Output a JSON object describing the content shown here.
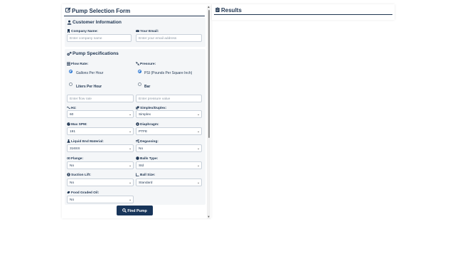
{
  "form": {
    "title": "Pump Selection Form",
    "customer_section": {
      "title": "Customer Information",
      "company_label": "Company Name:",
      "company_placeholder": "Enter company name",
      "email_label": "Your Email:",
      "email_placeholder": "Enter your email address"
    },
    "specs_section": {
      "title": "Pump Specifications",
      "flow_rate_label": "Flow Rate:",
      "flow_option_1": "Gallons Per Hour",
      "flow_option_2": "Liters Per Hour",
      "flow_selected": "Gallons Per Hour",
      "flow_placeholder": "Enter flow rate",
      "pressure_label": "Pressure:",
      "pressure_option_1": "PSI (Pounds Per Square Inch)",
      "pressure_option_2": "Bar",
      "pressure_selected": "PSI (Pounds Per Square Inch)",
      "pressure_placeholder": "Enter pressure value",
      "hz_label": "Hz:",
      "hz_value": "60",
      "simplex_label": "Simplex/Duplex:",
      "simplex_value": "Simplex",
      "max_spm_label": "Max SPM:",
      "max_spm_value": "191",
      "diaphragm_label": "Diaphragm:",
      "diaphragm_value": "PTFE",
      "liquid_end_label": "Liquid End Material:",
      "liquid_end_value": "316SS",
      "degassing_label": "Degassing:",
      "degassing_value": "No",
      "flange_label": "Flange:",
      "flange_value": "No",
      "balls_type_label": "Balls Type:",
      "balls_type_value": "Std",
      "suction_lift_label": "Suction Lift:",
      "suction_lift_value": "No",
      "ball_size_label": "Ball Size:",
      "ball_size_value": "Standard",
      "food_oil_label": "Food Graded Oil:",
      "food_oil_value": "No"
    },
    "submit_label": "Find Pump"
  },
  "results": {
    "title": "Results"
  },
  "colors": {
    "primary": "#1f3551",
    "button": "#18355a",
    "section_bg": "#f4f6f8",
    "radio_accent": "#1f6fd0"
  },
  "icons": {
    "form_header": "edit-icon",
    "customer": "user-icon",
    "specs": "cogs-icon",
    "results": "clipboard-icon",
    "submit": "search-icon"
  }
}
